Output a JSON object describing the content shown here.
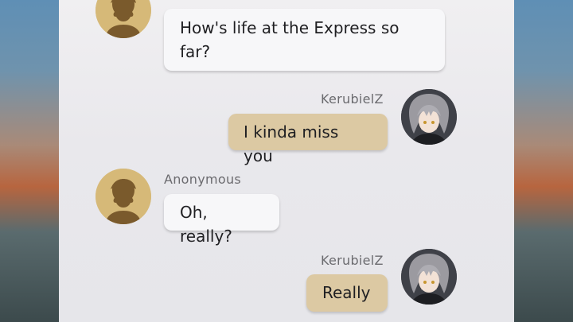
{
  "messages": [
    {
      "from": "anonymous",
      "sender": "",
      "text": "How's life at the Express so far?"
    },
    {
      "from": "self",
      "sender": "KerubielZ",
      "text": "I kinda miss you"
    },
    {
      "from": "anonymous",
      "sender": "Anonymous",
      "text": "Oh, really?"
    },
    {
      "from": "self",
      "sender": "KerubielZ",
      "text": "Really"
    }
  ],
  "colors": {
    "incoming_bubble": "#f7f7f9",
    "outgoing_bubble": "#dcc9a3",
    "anon_avatar": "#d6b978",
    "scrollbar": "#3d3d3f"
  },
  "icons": {
    "anonymous_avatar": "person-silhouette-icon",
    "user_avatar": "character-portrait-icon"
  }
}
